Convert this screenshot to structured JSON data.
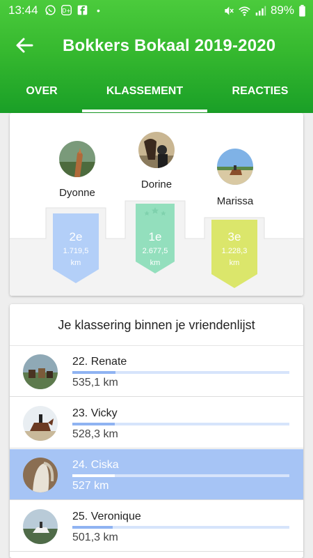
{
  "status": {
    "time": "13:44",
    "battery": "89%",
    "icons": [
      "whatsapp-icon",
      "disney-icon",
      "facebook-icon",
      "dot-icon",
      "mute-icon",
      "wifi-icon",
      "signal-icon",
      "battery-icon"
    ]
  },
  "appbar": {
    "title": "Bokkers Bokaal 2019-2020",
    "back_icon": "arrow-left-icon"
  },
  "tabs": [
    {
      "label": "OVER",
      "active": false
    },
    {
      "label": "KLASSEMENT",
      "active": true
    },
    {
      "label": "REACTIES",
      "active": false
    }
  ],
  "podium": [
    {
      "name": "Dyonne",
      "rank": "2e",
      "km": "1.719,5",
      "unit": "km",
      "color": "#b3cff8"
    },
    {
      "name": "Dorine",
      "rank": "1e",
      "km": "2.677,5",
      "unit": "km",
      "color": "#93dfbd"
    },
    {
      "name": "Marissa",
      "rank": "3e",
      "km": "1.228,3",
      "unit": "km",
      "color": "#dbe66b"
    }
  ],
  "ranking": {
    "heading": "Je klassering binnen je vriendenlijst",
    "rows": [
      {
        "label": "22. Renate",
        "km": "535,1 km",
        "progress": 0.2,
        "highlight": false
      },
      {
        "label": "23. Vicky",
        "km": "528,3 km",
        "progress": 0.197,
        "highlight": false
      },
      {
        "label": "24. Ciska",
        "km": "527 km",
        "progress": 0.197,
        "highlight": true
      },
      {
        "label": "25. Veronique",
        "km": "501,3 km",
        "progress": 0.187,
        "highlight": false
      }
    ]
  },
  "colors": {
    "appbar_green": "#36b92f",
    "highlight_blue": "#a6c4f5",
    "progress_blue": "#8fb3f2"
  }
}
